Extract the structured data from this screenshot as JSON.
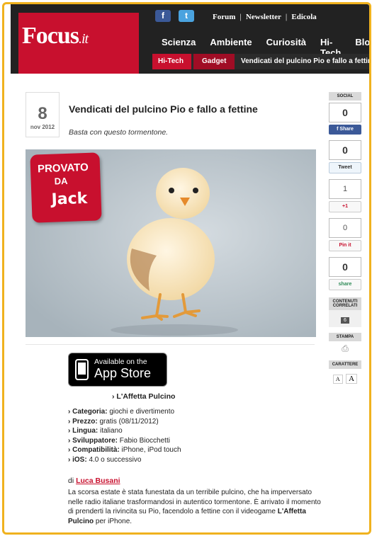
{
  "brand": {
    "logo_text": "Focus",
    "logo_suffix": ".it",
    "color": "#c8102e",
    "accent_frame": "#f0b21e"
  },
  "header": {
    "social_icons": [
      {
        "name": "facebook-icon",
        "glyph": "f",
        "color": "#3b5998"
      },
      {
        "name": "twitter-icon",
        "glyph": "t",
        "color": "#4aa3df"
      }
    ],
    "top_links": [
      "Forum",
      "Newsletter",
      "Edicola"
    ],
    "nav": [
      {
        "label": "Scienza",
        "color": "#f39c12"
      },
      {
        "label": "Ambiente",
        "color": "#6ab04c"
      },
      {
        "label": "Curiosità",
        "color": "#e84393"
      },
      {
        "label": "Hi-Tech",
        "color": "#c8102e"
      },
      {
        "label": "Blog",
        "color": "#f0b21e"
      }
    ],
    "breadcrumb": [
      "Hi-Tech",
      "Gadget",
      "Vendicati del pulcino Pio e fallo a fettine"
    ]
  },
  "article": {
    "date_day": "8",
    "date_month": "nov 2012",
    "title": "Vendicati del pulcino Pio e fallo a fettine",
    "subtitle": "Basta con questo tormentone.",
    "badge": {
      "line1": "PROVATO",
      "line2": "DA",
      "line3": "Jack"
    },
    "appstore": {
      "small": "Available on the",
      "big": "App Store"
    },
    "app_name": "› L'Affetta Pulcino",
    "specs": [
      {
        "label": "› Categoria:",
        "value": " giochi e divertimento"
      },
      {
        "label": "› Prezzo:",
        "value": " gratis (08/11/2012)"
      },
      {
        "label": "› Lingua:",
        "value": " italiano"
      },
      {
        "label": "› Sviluppatore:",
        "value": " Fabio Biocchetti"
      },
      {
        "label": "› Compatibilità:",
        "value": " iPhone, iPod touch"
      },
      {
        "label": "› iOS:",
        "value": " 4.0 o successivo"
      }
    ],
    "author_prefix": "di ",
    "author": "Luca Busani",
    "body_1": "La scorsa estate è stata funestata da un terribile pulcino, che ha imperversato nelle radio italiane trasformandosi in autentico tormentone. È arrivato il momento di prenderti la rivincita su Pio, facendolo a fettine con il videogame ",
    "body_bold": "L'Affetta Pulcino",
    "body_2": " per iPhone."
  },
  "sidebar": {
    "social_head": "SOCIAL",
    "counts": [
      {
        "value": "0",
        "button": "f Share",
        "color": "#3b5998",
        "size": "big"
      },
      {
        "value": "0",
        "button": "Tweet",
        "color": "#eef5fb",
        "text": "#333",
        "size": "big"
      },
      {
        "value": "1",
        "button": "+1",
        "color": "#f8f8f8",
        "text": "#c8102e",
        "size": "small"
      },
      {
        "value": "0",
        "button": "Pin it",
        "color": "#f8f8f8",
        "text": "#c8102e",
        "size": "small"
      },
      {
        "value": "0",
        "button": "share",
        "color": "#f8f8f8",
        "text": "#2e8b57",
        "size": "big"
      }
    ],
    "related_head": "CONTENUTI CORRELATI",
    "related_count": "6",
    "print_head": "STAMPA",
    "font_head": "CARATTERE",
    "font_small": "A",
    "font_big": "A"
  }
}
